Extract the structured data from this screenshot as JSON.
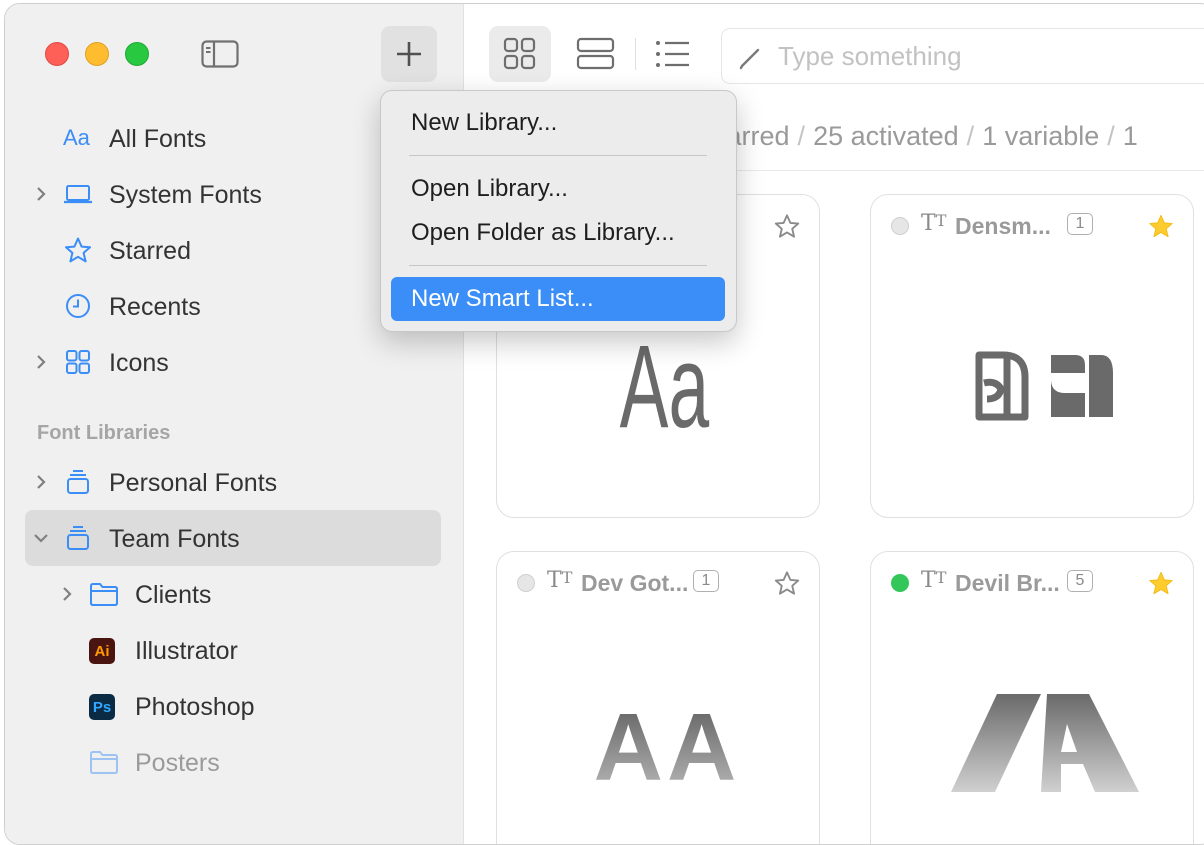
{
  "sidebar": {
    "items": [
      {
        "label": "All Fonts",
        "icon": "aa-icon"
      },
      {
        "label": "System Fonts",
        "icon": "laptop-icon"
      },
      {
        "label": "Starred",
        "icon": "star-icon"
      },
      {
        "label": "Recents",
        "icon": "clock-icon"
      },
      {
        "label": "Icons",
        "icon": "grid-icon"
      }
    ],
    "aa_glyph": "Aa",
    "section_title": "Font Libraries",
    "libraries": [
      {
        "label": "Personal Fonts",
        "icon": "library-icon"
      },
      {
        "label": "Team Fonts",
        "icon": "library-icon",
        "selected": true
      }
    ],
    "team_children": [
      {
        "label": "Clients",
        "icon": "folder-icon"
      },
      {
        "label": "Illustrator",
        "icon": "illustrator-icon",
        "badge": "Ai"
      },
      {
        "label": "Photoshop",
        "icon": "photoshop-icon",
        "badge": "Ps"
      },
      {
        "label": "Posters",
        "icon": "folder-icon"
      }
    ]
  },
  "toolbar": {
    "search_placeholder": "Type something"
  },
  "stats": {
    "starred": "tarred",
    "activated": "25 activated",
    "variable": "1 variable",
    "more": "1",
    "separator": "/"
  },
  "cards": [
    {
      "name": "",
      "count": "",
      "starred": false,
      "active": false,
      "preview": "Aa"
    },
    {
      "name": "Densm...",
      "count": "1",
      "starred": true,
      "active": false
    },
    {
      "name": "Dev Got...",
      "count": "1",
      "starred": false,
      "active": false,
      "preview": "AA"
    },
    {
      "name": "Devil Br...",
      "count": "5",
      "starred": true,
      "active": true
    }
  ],
  "menu": {
    "items": [
      {
        "label": "New Library..."
      },
      {
        "label": "Open Library..."
      },
      {
        "label": "Open Folder as Library..."
      },
      {
        "label": "New Smart List...",
        "highlighted": true
      }
    ]
  },
  "colors": {
    "accent": "#3b8ef7",
    "star_filled": "#fecc2f",
    "active_dot": "#33c75a"
  }
}
